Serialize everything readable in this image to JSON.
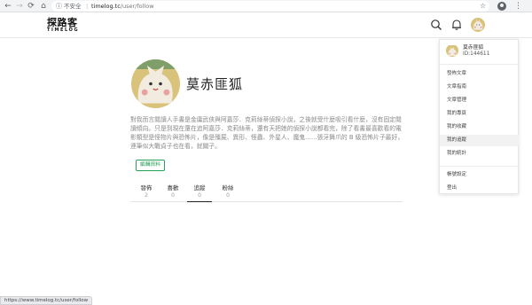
{
  "browser": {
    "security_label": "不安全",
    "url_host": "timelog.tc",
    "url_path": "/user/follow",
    "status_url": "https://www.timelog.tc/user/follow"
  },
  "site": {
    "logo_cn": "探路客",
    "logo_en": "TIMELOG"
  },
  "profile": {
    "name": "莫赤匪狐",
    "bio": "對我而言閱讀人手書是金庸武俠與阿嘉莎．克莉絲蒂偵探小說，之後就受什麼吸引看什麼，沒有固定閱讀傾向。只是到現在還在追阿嘉莎．克莉絲蒂，還有天把她的偵探小說都看完，除了看書最喜歡看的電影類型是怪物片與恐怖片，像是殭屍、異形、怪蟲、外星人、魔鬼……張牙舞爪的 B 級恐怖片子最好，連筆似大戰貞子也在看，就關子。",
    "edit_label": "編輯資料"
  },
  "tabs": [
    {
      "label": "發佈",
      "count": "2"
    },
    {
      "label": "喜歡",
      "count": "0"
    },
    {
      "label": "追蹤",
      "count": "0"
    },
    {
      "label": "粉絲",
      "count": "0"
    }
  ],
  "active_tab": "追蹤",
  "dropdown": {
    "name": "莫赤匪狐",
    "id": "ID:144611",
    "items": [
      "發佈文章",
      "文章指南",
      "文章管理",
      "我的專頁",
      "我的收藏",
      "我的追蹤",
      "我的統計"
    ],
    "hovered_item": "我的追蹤",
    "footer_items": [
      "帳號設定",
      "登出"
    ]
  },
  "colors": {
    "accent": "#27a15a",
    "avatar_bg": "#d9c27a"
  },
  "icons": [
    "back-icon",
    "forward-icon",
    "reload-icon",
    "home-icon",
    "info-icon",
    "star-icon",
    "profile-icon",
    "menu-kebab-icon",
    "search-icon",
    "bell-icon"
  ]
}
